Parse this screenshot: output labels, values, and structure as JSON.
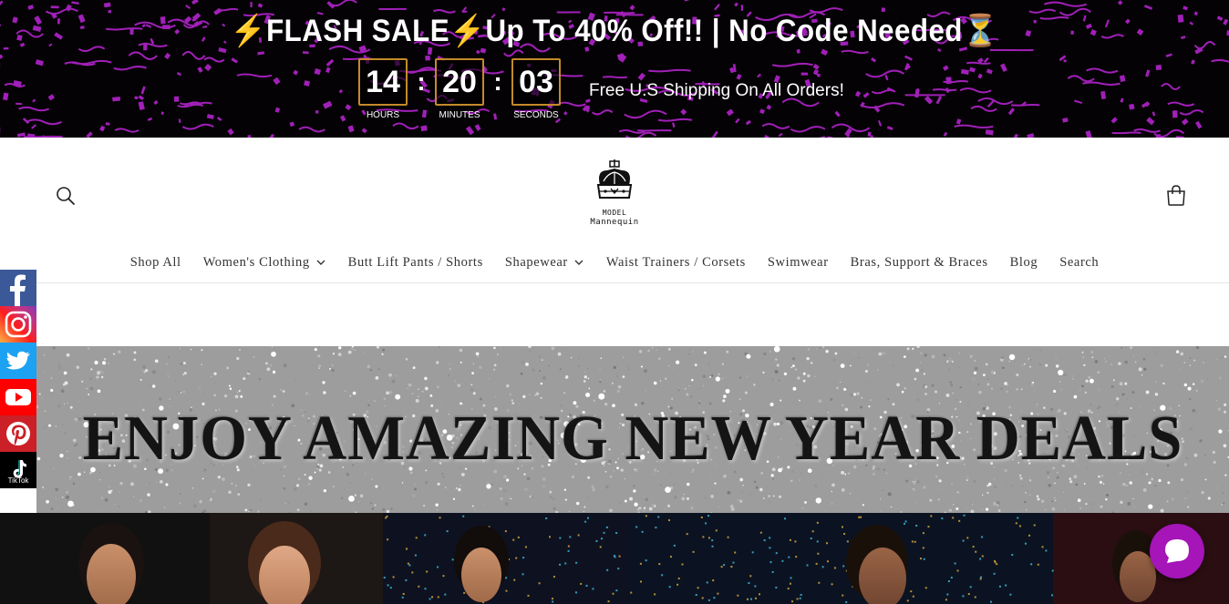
{
  "promo": {
    "title_bolt_left": "⚡",
    "title_part1": "FLASH SALE",
    "title_bolt_mid": "⚡",
    "title_part2": "Up To 40% Off!! | No Code Needed",
    "title_hourglass": "⏳",
    "countdown": {
      "hours": "14",
      "hours_label": "HOURS",
      "minutes": "20",
      "minutes_label": "MINUTES",
      "seconds": "03",
      "seconds_label": "SECONDS",
      "separator": ":"
    },
    "shipping": "Free U.S Shipping On All Orders!",
    "confetti_color": "#a020b8",
    "background_color": "#050205"
  },
  "header": {
    "logo_line1": "MODEL",
    "logo_line2": "Mannequin",
    "search_icon": "search-icon",
    "cart_icon": "cart-icon"
  },
  "nav": {
    "items": [
      {
        "label": "Shop All",
        "has_dropdown": false
      },
      {
        "label": "Women's Clothing",
        "has_dropdown": true
      },
      {
        "label": "Butt Lift Pants / Shorts",
        "has_dropdown": false
      },
      {
        "label": "Shapewear",
        "has_dropdown": true
      },
      {
        "label": "Waist Trainers / Corsets",
        "has_dropdown": false
      },
      {
        "label": "Swimwear",
        "has_dropdown": false
      },
      {
        "label": "Bras, Support & Braces",
        "has_dropdown": false
      },
      {
        "label": "Blog",
        "has_dropdown": false
      },
      {
        "label": "Search",
        "has_dropdown": false
      }
    ]
  },
  "social": {
    "items": [
      {
        "name": "facebook",
        "color": "#3b5998"
      },
      {
        "name": "instagram",
        "color": "#d6249f"
      },
      {
        "name": "twitter",
        "color": "#1da1f2"
      },
      {
        "name": "youtube",
        "color": "#ff0000"
      },
      {
        "name": "pinterest",
        "color": "#cb2027"
      },
      {
        "name": "tiktok",
        "color": "#000000",
        "label": "TikTok"
      }
    ]
  },
  "banner": {
    "text": "ENJOY AMAZING NEW YEAR DEALS"
  },
  "chat": {
    "icon": "chat-bubble-icon",
    "color": "#a515b8"
  }
}
